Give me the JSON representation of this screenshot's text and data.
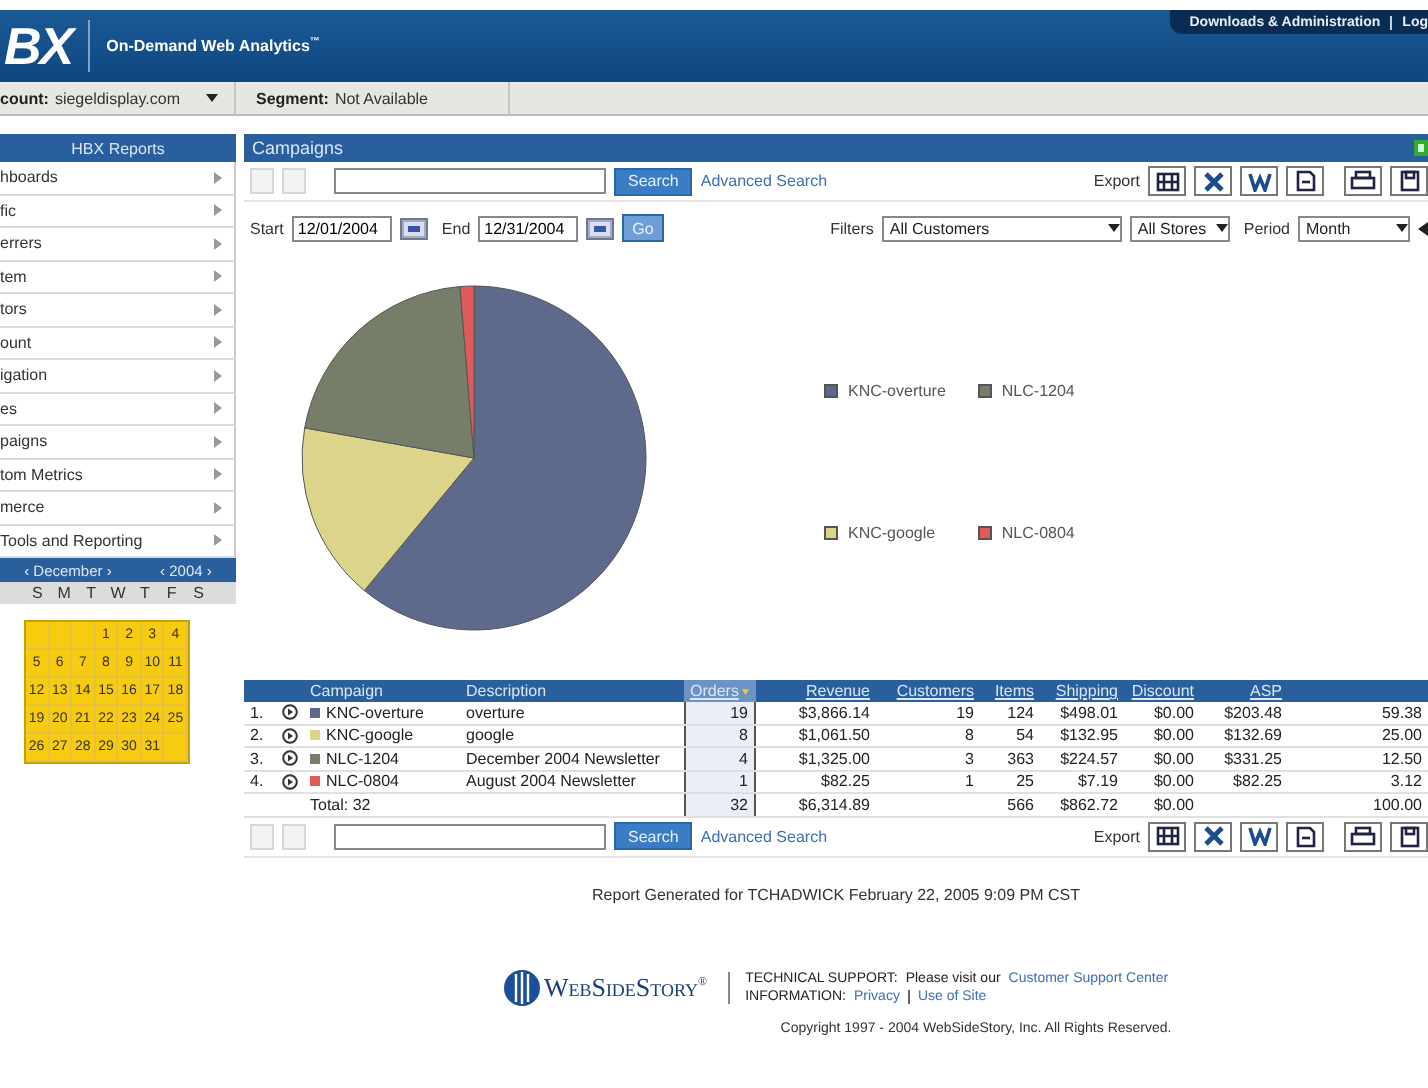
{
  "header": {
    "logo": "BX",
    "tagline": "On-Demand Web Analytics$^{™}$",
    "links": [
      "Downloads & Administration",
      "Log"
    ]
  },
  "account_bar": {
    "account_label": "count:",
    "account": "siegeldisplay.com",
    "segment_label": "Segment:",
    "segment": "Not Available"
  },
  "sidebar": {
    "title": "HBX Reports",
    "items": [
      {
        "label": "hboards"
      },
      {
        "label": "fic"
      },
      {
        "label": "errers"
      },
      {
        "label": "tem"
      },
      {
        "label": "tors"
      },
      {
        "label": "ount"
      },
      {
        "label": "igation"
      },
      {
        "label": "es"
      },
      {
        "label": "paigns"
      },
      {
        "label": "tom Metrics"
      },
      {
        "label": "merce"
      },
      {
        "label": "Tools and Reporting"
      }
    ],
    "calendar": {
      "month": "‹ December ›",
      "year": "‹ 2004 ›",
      "weekdays": [
        "S",
        "M",
        "T",
        "W",
        "T",
        "F",
        "S"
      ],
      "range_selected": true,
      "weeks": [
        [
          "1",
          "2",
          "3",
          "4"
        ],
        [
          "5",
          "6",
          "7",
          "8",
          "9",
          "10",
          "11"
        ],
        [
          "12",
          "13",
          "14",
          "15",
          "16",
          "17",
          "18"
        ],
        [
          "19",
          "20",
          "21",
          "22",
          "23",
          "24",
          "25"
        ],
        [
          "26",
          "27",
          "28",
          "29",
          "30",
          "31"
        ]
      ]
    }
  },
  "panel": {
    "title": "Campaigns",
    "search": {
      "button": "Search",
      "link": "Advanced Search",
      "export_label": "Export"
    },
    "dates": {
      "start_label": "Start",
      "start": "12/01/2004",
      "end_label": "End",
      "end": "12/31/2004",
      "go": "Go",
      "filters_label": "Filters",
      "filters": [
        "All Customers",
        "All Stores"
      ],
      "period_label": "Period",
      "period": "Month"
    },
    "chart": {
      "chart_data": {
        "type": "pie",
        "categories": [
          "KNC-overture",
          "KNC-google",
          "NLC-1204",
          "NLC-0804"
        ],
        "values": [
          61.0,
          16.8,
          20.9,
          1.3
        ]
      },
      "legend": [
        {
          "color": "#5d6a8c"
        },
        {
          "color": "#dcd48a"
        },
        {
          "color": "#767d68"
        },
        {
          "color": "#e05a5a"
        }
      ]
    },
    "table": {
      "columns": [
        {
          "label": "Campaign",
          "sortable": false,
          "sorted": false
        },
        {
          "label": "Description",
          "sortable": false,
          "sorted": false
        },
        {
          "label": "Orders",
          "sortable": true,
          "sorted": true
        },
        {
          "label": "Revenue",
          "sortable": true,
          "sorted": false
        },
        {
          "label": "Customers",
          "sortable": true,
          "sorted": false
        },
        {
          "label": "Items",
          "sortable": true,
          "sorted": false
        },
        {
          "label": "Shipping",
          "sortable": true,
          "sorted": false
        },
        {
          "label": "Discount",
          "sortable": true,
          "sorted": false
        },
        {
          "label": "ASP",
          "sortable": true,
          "sorted": false
        }
      ],
      "rows": [
        {
          "index": "1.",
          "color": "#5d6a8c",
          "cells": [
            "KNC-overture",
            "overture",
            "19",
            "$3,866.14",
            "19",
            "124",
            "$498.01",
            "$0.00",
            "$203.48",
            "59.38"
          ]
        },
        {
          "index": "2.",
          "color": "#dcd48a",
          "cells": [
            "KNC-google",
            "google",
            "8",
            "$1,061.50",
            "8",
            "54",
            "$132.95",
            "$0.00",
            "$132.69",
            "25.00"
          ]
        },
        {
          "index": "3.",
          "color": "#767d68",
          "cells": [
            "NLC-1204",
            "December 2004 Newsletter",
            "4",
            "$1,325.00",
            "3",
            "363",
            "$224.57",
            "$0.00",
            "$331.25",
            "12.50"
          ]
        },
        {
          "index": "4.",
          "color": "#e05a5a",
          "cells": [
            "NLC-0804",
            "August 2004 Newsletter",
            "1",
            "$82.25",
            "1",
            "25",
            "$7.19",
            "$0.00",
            "$82.25",
            "3.12"
          ]
        }
      ],
      "total": {
        "cells": [
          "Total: 32",
          "",
          "32",
          "$6,314.89",
          "",
          "566",
          "$862.72",
          "$0.00",
          "",
          "100.00"
        ]
      }
    },
    "bottom_search": {
      "button": "Search",
      "link": "Advanced Search",
      "export_label": "Export"
    }
  },
  "footer": {
    "report": "Report Generated for TCHADWICK February 22, 2005 9:09 PM CST",
    "brand": "WebSideStory$^{®}$",
    "support_label": "TECHNICAL SUPPORT:",
    "support_text": "Please visit our",
    "support_link": "Customer Support Center",
    "info_label": "INFORMATION:",
    "info_links": [
      "Privacy",
      "Use of Site"
    ],
    "copyright": "Copyright 1997 - 2004 WebSideStory, Inc. All Rights Reserved."
  }
}
